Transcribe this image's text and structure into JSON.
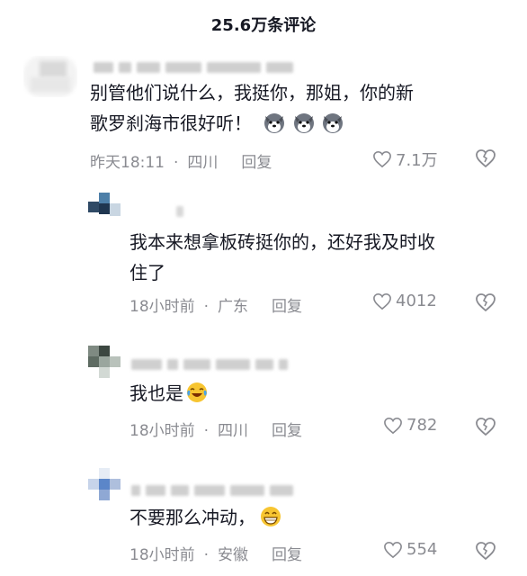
{
  "header": {
    "title": "25.6万条评论"
  },
  "comments": [
    {
      "text_line1": "别管他们说什么，我挺你，那姐，你的新",
      "text_line2": "歌罗刹海市很好听！",
      "time": "昨天18:11",
      "location": "四川",
      "reply_label": "回复",
      "likes": "7.1万",
      "emoji": [
        "husky-emoji",
        "husky-emoji",
        "husky-emoji"
      ]
    },
    {
      "text_line1": "我本来想拿板砖挺你的，还好我及时收",
      "text_line2": "住了",
      "time": "18小时前",
      "location": "广东",
      "reply_label": "回复",
      "likes": "4012"
    },
    {
      "text_line1": "我也是",
      "time": "18小时前",
      "location": "四川",
      "reply_label": "回复",
      "likes": "782",
      "emoji": [
        "laugh-cry-emoji"
      ]
    },
    {
      "text_line1": "不要那么冲动，",
      "time": "18小时前",
      "location": "安徽",
      "reply_label": "回复",
      "likes": "554",
      "emoji": [
        "grin-emoji"
      ]
    }
  ],
  "colors": {
    "text": "#161823",
    "meta": "#8a8b91",
    "background": "#ffffff"
  }
}
